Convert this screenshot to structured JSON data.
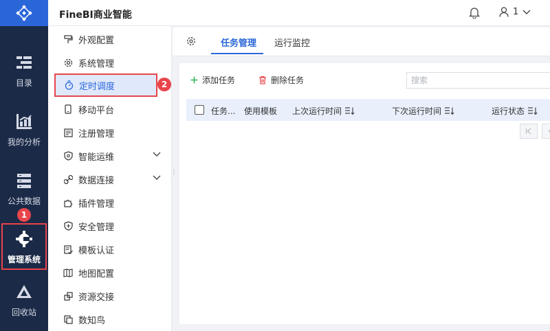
{
  "app": {
    "title": "FineBI商业智能"
  },
  "header": {
    "user_name": "1"
  },
  "rail": {
    "items": [
      {
        "label": "目录",
        "icon": "list-icon"
      },
      {
        "label": "我的分析",
        "icon": "analysis-icon"
      },
      {
        "label": "公共数据",
        "icon": "database-icon"
      },
      {
        "label": "管理系统",
        "icon": "settings-gear-icon",
        "badge": "1"
      },
      {
        "label": "回收站",
        "icon": "recycle-icon"
      }
    ]
  },
  "menu": {
    "items": [
      {
        "label": "外观配置",
        "icon": "paint-roller-icon"
      },
      {
        "label": "系统管理",
        "icon": "gear-icon"
      },
      {
        "label": "定时调度",
        "icon": "timer-icon",
        "badge": "2"
      },
      {
        "label": "移动平台",
        "icon": "mobile-icon"
      },
      {
        "label": "注册管理",
        "icon": "register-icon"
      },
      {
        "label": "智能运维",
        "icon": "shield-wrench-icon"
      },
      {
        "label": "数据连接",
        "icon": "link-icon"
      },
      {
        "label": "插件管理",
        "icon": "puzzle-icon"
      },
      {
        "label": "安全管理",
        "icon": "shield-icon"
      },
      {
        "label": "模板认证",
        "icon": "certificate-icon"
      },
      {
        "label": "地图配置",
        "icon": "map-icon"
      },
      {
        "label": "资源交接",
        "icon": "handover-icon"
      },
      {
        "label": "数知鸟",
        "icon": "copy-icon"
      }
    ]
  },
  "tabs": [
    {
      "label": "任务管理"
    },
    {
      "label": "运行监控"
    }
  ],
  "toolbar": {
    "add_label": "添加任务",
    "delete_label": "删除任务",
    "search_placeholder": "搜索"
  },
  "table": {
    "columns": [
      "任务...",
      "使用模板",
      "上次运行时间",
      "下次运行时间",
      "运行状态"
    ]
  },
  "colors": {
    "rail_bg": "#1b2a47",
    "brand_blue": "#2b66d9",
    "highlight_red": "#e8454b",
    "add_green": "#2fb350",
    "delete_red": "#e8454b"
  }
}
